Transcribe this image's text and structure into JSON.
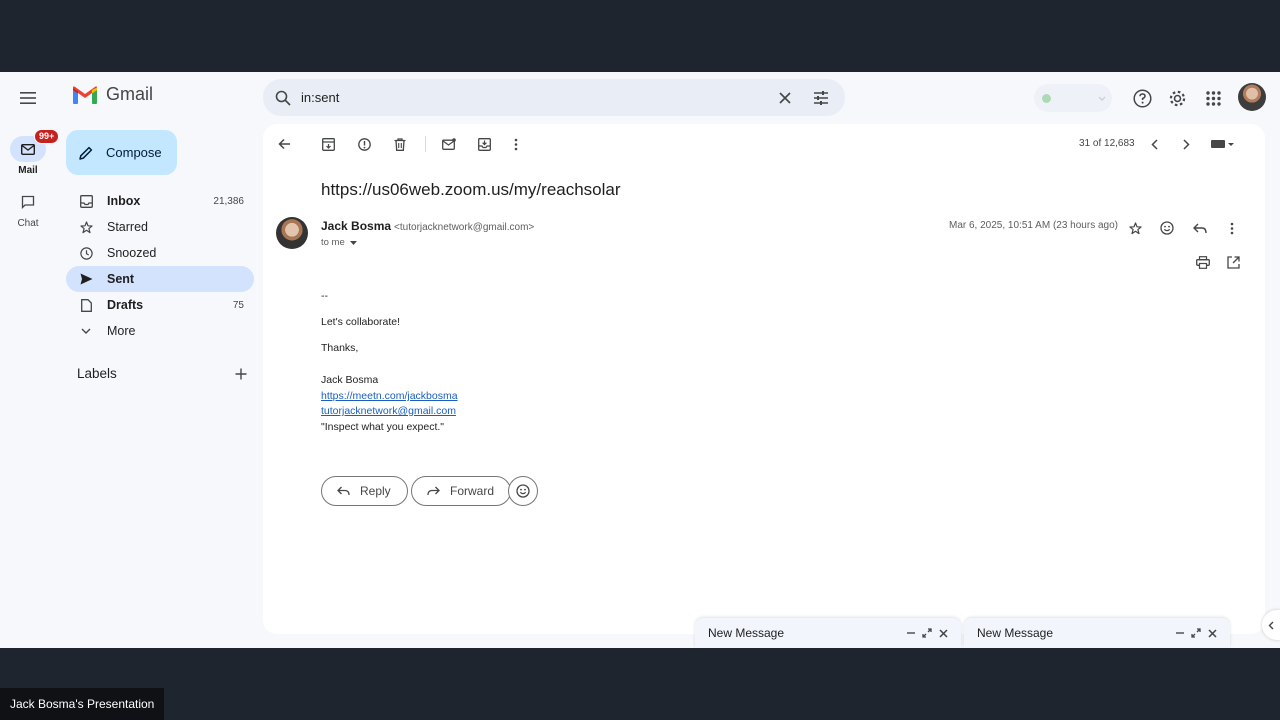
{
  "app": {
    "name": "Gmail"
  },
  "rail": {
    "mail": {
      "label": "Mail",
      "badge": "99+"
    },
    "chat": {
      "label": "Chat"
    }
  },
  "compose": {
    "label": "Compose"
  },
  "sidebar": {
    "items": [
      {
        "label": "Inbox",
        "count": "21,386",
        "icon": "inbox-icon"
      },
      {
        "label": "Starred",
        "count": "",
        "icon": "star-icon"
      },
      {
        "label": "Snoozed",
        "count": "",
        "icon": "clock-icon"
      },
      {
        "label": "Sent",
        "count": "",
        "icon": "send-icon"
      },
      {
        "label": "Drafts",
        "count": "75",
        "icon": "draft-icon"
      },
      {
        "label": "More",
        "count": "",
        "icon": "chevron-down-icon"
      }
    ],
    "labels_title": "Labels"
  },
  "search": {
    "value": "in:sent"
  },
  "toolbar": {
    "pager": "31 of 12,683"
  },
  "email": {
    "subject": "https://us06web.zoom.us/my/reachsolar",
    "sender_name": "Jack Bosma",
    "sender_email": "<tutorjacknetwork@gmail.com>",
    "to": "to me",
    "date": "Mar 6, 2025, 10:51 AM (23 hours ago)",
    "body": {
      "sig_sep": "--",
      "line1": "Let's collaborate!",
      "line2": "Thanks,",
      "name": "Jack Bosma",
      "link1": "https://meetn.com/jackbosma",
      "link2": "tutorjacknetwork@gmail.com",
      "quote": "\"Inspect what you expect.\""
    }
  },
  "actions": {
    "reply": "Reply",
    "forward": "Forward"
  },
  "drafts": [
    {
      "title": "New Message"
    },
    {
      "title": "New Message"
    }
  ],
  "presentation_label": "Jack Bosma's Presentation",
  "colors": {
    "accent": "#c2e7ff",
    "selected": "#d3e3fd",
    "badge": "#c5221f",
    "link": "#1a5fbf"
  }
}
